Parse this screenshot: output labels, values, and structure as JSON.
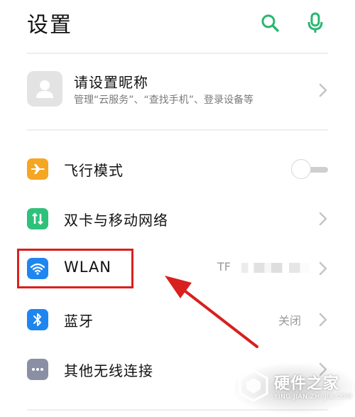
{
  "header": {
    "title": "设置",
    "search_icon": "search-icon",
    "mic_icon": "mic-icon",
    "accent_color": "#2bb673"
  },
  "profile": {
    "name": "请设置昵称",
    "subtitle": "管理“云服务”、“查找手机”、登录设备等"
  },
  "settings": [
    {
      "label": "飞行模式",
      "icon": "airplane-icon",
      "icon_color": "#f5a623",
      "toggle_on": false
    },
    {
      "label": "双卡与移动网络",
      "icon": "dual-sim-icon",
      "icon_color": "#2ec17a"
    },
    {
      "label": "WLAN",
      "icon": "wifi-icon",
      "icon_color": "#1f86f0",
      "value": "TF"
    },
    {
      "label": "蓝牙",
      "icon": "bluetooth-icon",
      "icon_color": "#1f86f0",
      "value": "关闭"
    },
    {
      "label": "其他无线连接",
      "icon": "more-icon",
      "icon_color": "#8a8fa3"
    }
  ],
  "annotation": {
    "highlight_color": "#d8201f"
  },
  "watermark": {
    "title": "硬件之家",
    "subtitle": "YING JIAN ZHI JIA.COM"
  }
}
